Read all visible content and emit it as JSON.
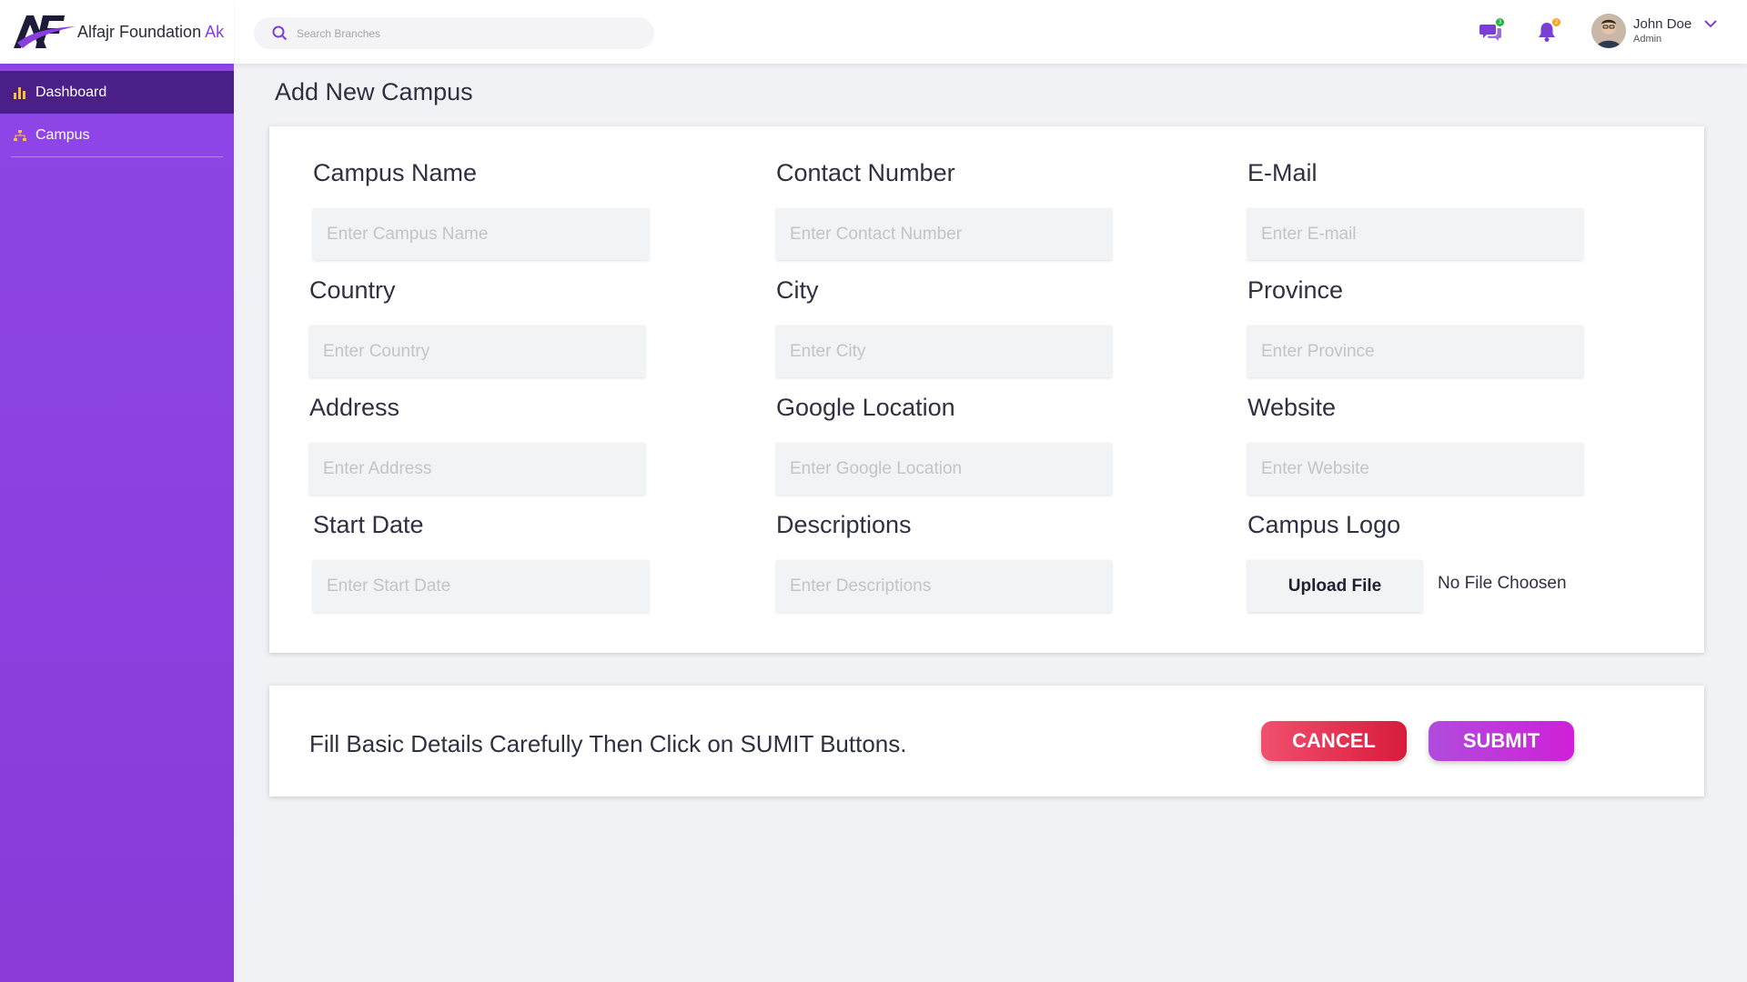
{
  "brand": {
    "name": "Alfajr Foundation",
    "suffix": "Ak",
    "logo_text": "AF"
  },
  "sidebar": {
    "items": [
      {
        "label": "Dashboard",
        "icon": "bar-chart-icon",
        "active": true
      },
      {
        "label": "Campus",
        "icon": "sitemap-icon",
        "active": false
      }
    ]
  },
  "topbar": {
    "search_placeholder": "Search Branches",
    "messages_count": "3",
    "notifications_count": "2",
    "user": {
      "name": "John Doe",
      "role": "Admin"
    }
  },
  "page": {
    "title": "Add New Campus"
  },
  "form": {
    "campus_name": {
      "label": "Campus Name",
      "placeholder": "Enter Campus Name",
      "value": ""
    },
    "contact_number": {
      "label": "Contact Number",
      "placeholder": "Enter Contact Number",
      "value": ""
    },
    "email": {
      "label": "E-Mail",
      "placeholder": "Enter E-mail",
      "value": ""
    },
    "country": {
      "label": "Country",
      "placeholder": "Enter Country",
      "value": ""
    },
    "city": {
      "label": "City",
      "placeholder": "Enter City",
      "value": ""
    },
    "province": {
      "label": "Province",
      "placeholder": "Enter Province",
      "value": ""
    },
    "address": {
      "label": "Address",
      "placeholder": "Enter Address",
      "value": ""
    },
    "google_location": {
      "label": "Google Location",
      "placeholder": "Enter Google Location",
      "value": ""
    },
    "website": {
      "label": "Website",
      "placeholder": "Enter Website",
      "value": ""
    },
    "start_date": {
      "label": "Start Date",
      "placeholder": "Enter Start Date",
      "value": ""
    },
    "descriptions": {
      "label": "Descriptions",
      "placeholder": "Enter Descriptions",
      "value": ""
    },
    "campus_logo": {
      "label": "Campus Logo",
      "button": "Upload File",
      "status": "No File Choosen"
    }
  },
  "footer": {
    "hint": "Fill Basic Details Carefully Then Click on SUMIT Buttons.",
    "cancel_label": "CANCEL",
    "submit_label": "SUBMIT"
  },
  "colors": {
    "sidebar": "#8f46e8",
    "sidebar_active": "#4a1f87",
    "accent": "#8a3ee0",
    "cancel": "#e5304f",
    "submit": "#c034da",
    "message_badge": "#22b24c",
    "notification_badge": "#f5a623"
  }
}
